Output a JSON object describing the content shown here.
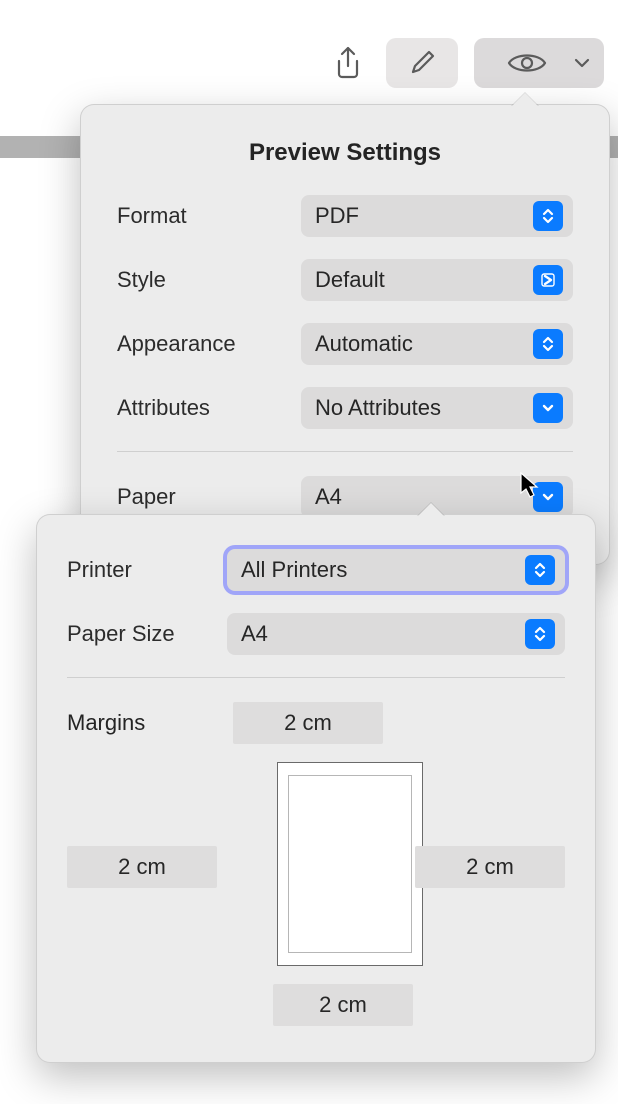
{
  "toolbar": {
    "share": "share",
    "edit": "edit",
    "view": "view"
  },
  "pop1": {
    "title": "Preview Settings",
    "format_label": "Format",
    "format_value": "PDF",
    "style_label": "Style",
    "style_value": "Default",
    "appearance_label": "Appearance",
    "appearance_value": "Automatic",
    "attributes_label": "Attributes",
    "attributes_value": "No Attributes",
    "paper_label": "Paper",
    "paper_value": "A4"
  },
  "pop2": {
    "printer_label": "Printer",
    "printer_value": "All Printers",
    "papersize_label": "Paper Size",
    "papersize_value": "A4",
    "margins_label": "Margins",
    "margin_top": "2 cm",
    "margin_left": "2 cm",
    "margin_right": "2 cm",
    "margin_bottom": "2 cm"
  }
}
